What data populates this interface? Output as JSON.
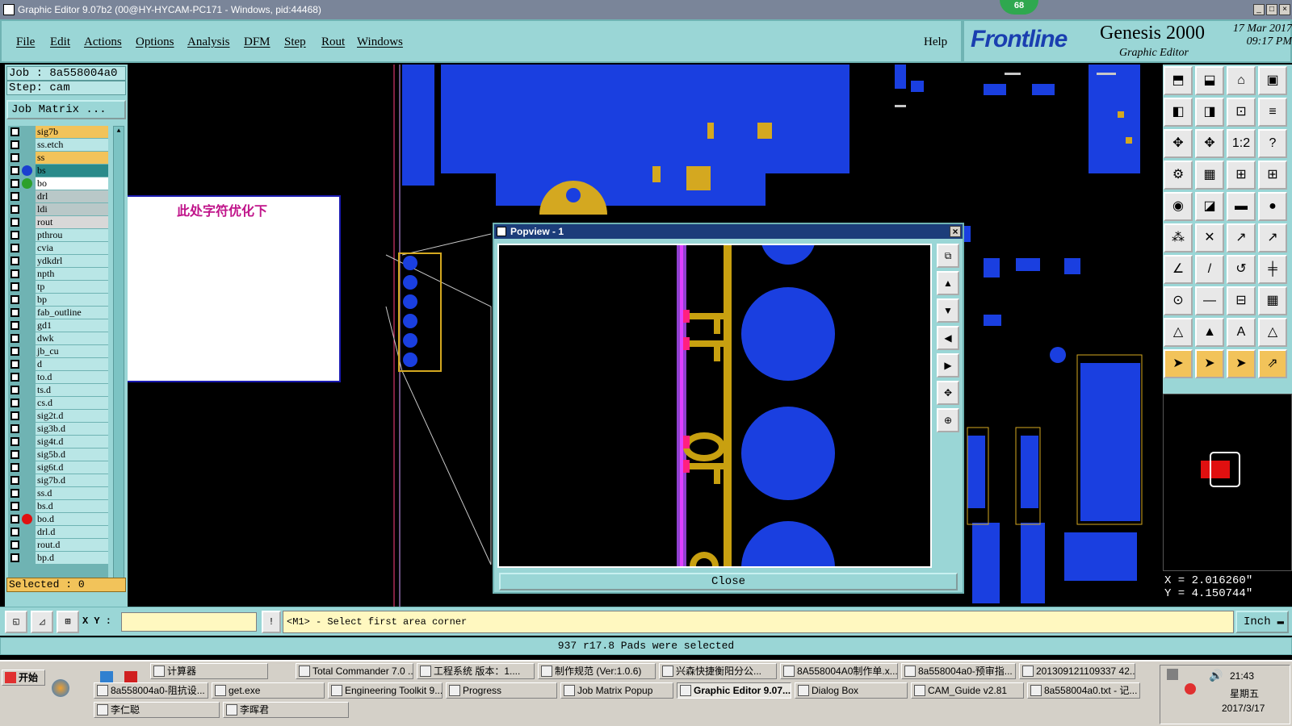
{
  "window": {
    "title": "Graphic Editor 9.07b2 (00@HY-HYCAM-PC171 - Windows, pid:44468)",
    "badge": "68",
    "min": "_",
    "max": "□",
    "close": "×"
  },
  "menu": [
    "File",
    "Edit",
    "Actions",
    "Options",
    "Analysis",
    "DFM",
    "Step",
    "Rout",
    "Windows"
  ],
  "help": "Help",
  "brand": {
    "logo": "Frontline",
    "product": "Genesis 2000",
    "subtitle": "Graphic Editor",
    "date": "17 Mar 2017",
    "time": "09:17 PM"
  },
  "job": {
    "job_label": "Job : 8a558004a0",
    "step_label": "Step: cam",
    "matrix_button": "Job Matrix ..."
  },
  "layers": [
    {
      "name": "sig7b",
      "bg": "#f2c35a"
    },
    {
      "name": "ss.etch",
      "bg": "#b9e6e6"
    },
    {
      "name": "ss",
      "bg": "#f2c35a"
    },
    {
      "name": "bs",
      "bg": "#2a8a8a",
      "dot": "#1a3fd0"
    },
    {
      "name": "bo",
      "bg": "#ffffff",
      "dot": "#2ca02c"
    },
    {
      "name": "drl",
      "bg": "#b9c8c8"
    },
    {
      "name": "ldi",
      "bg": "#b9c8c8"
    },
    {
      "name": "rout",
      "bg": "#d8d8d8"
    },
    {
      "name": "pthrou",
      "bg": "#b9e6e6"
    },
    {
      "name": "cvia",
      "bg": "#b9e6e6"
    },
    {
      "name": "ydkdrl",
      "bg": "#b9e6e6"
    },
    {
      "name": "npth",
      "bg": "#b9e6e6"
    },
    {
      "name": "tp",
      "bg": "#b9e6e6"
    },
    {
      "name": "bp",
      "bg": "#b9e6e6"
    },
    {
      "name": "fab_outline",
      "bg": "#b9e6e6"
    },
    {
      "name": "gd1",
      "bg": "#b9e6e6"
    },
    {
      "name": "dwk",
      "bg": "#b9e6e6"
    },
    {
      "name": "jb_cu",
      "bg": "#b9e6e6"
    },
    {
      "name": "d",
      "bg": "#b9e6e6"
    },
    {
      "name": "to.d",
      "bg": "#b9e6e6"
    },
    {
      "name": "ts.d",
      "bg": "#b9e6e6"
    },
    {
      "name": "cs.d",
      "bg": "#b9e6e6"
    },
    {
      "name": "sig2t.d",
      "bg": "#b9e6e6"
    },
    {
      "name": "sig3b.d",
      "bg": "#b9e6e6"
    },
    {
      "name": "sig4t.d",
      "bg": "#b9e6e6"
    },
    {
      "name": "sig5b.d",
      "bg": "#b9e6e6"
    },
    {
      "name": "sig6t.d",
      "bg": "#b9e6e6"
    },
    {
      "name": "sig7b.d",
      "bg": "#b9e6e6"
    },
    {
      "name": "ss.d",
      "bg": "#b9e6e6"
    },
    {
      "name": "bs.d",
      "bg": "#b9e6e6"
    },
    {
      "name": "bo.d",
      "bg": "#b9e6e6",
      "dot": "#e01010"
    },
    {
      "name": "drl.d",
      "bg": "#b9e6e6"
    },
    {
      "name": "rout.d",
      "bg": "#b9e6e6"
    },
    {
      "name": "bp.d",
      "bg": "#b9e6e6"
    }
  ],
  "selected": "Selected : 0",
  "note": "此处字符优化下",
  "popview": {
    "title": "Popview - 1",
    "close": "Close"
  },
  "coords": {
    "x": "X = 2.016260\"",
    "y": "Y = 4.150744\""
  },
  "cmd": {
    "xy_label": "X Y :",
    "xy_value": "",
    "prompt": "<M1> - Select first area corner",
    "units": "Inch"
  },
  "status": "937 r17.8 Pads were selected",
  "taskbar": {
    "start": "开始",
    "row1": [
      "计算器",
      "Total Commander 7.0 ...",
      "工程系统  版本：1....",
      "制作规范 (Ver:1.0.6)",
      "兴森快捷衡阳分公...",
      "8A558004A0制作单.x...",
      "8a558004a0-预审指...",
      "201309121109337 42...."
    ],
    "row2": [
      "8a558004a0-阻抗设...",
      "get.exe",
      "Engineering Toolkit 9....",
      "Progress",
      "Job Matrix Popup",
      "Graphic Editor 9.07...",
      "Dialog Box",
      "CAM_Guide v2.81",
      "8a558004a0.txt - 记..."
    ],
    "row3": [
      "李仁聪",
      "李晖君"
    ],
    "clock_time": "21:43",
    "clock_day": "星期五",
    "clock_date": "2017/3/17"
  },
  "colors": {
    "panel": "#9ad6d6",
    "copper": "#1a3fe0",
    "silk": "#c8a010",
    "accent": "#e01060"
  }
}
